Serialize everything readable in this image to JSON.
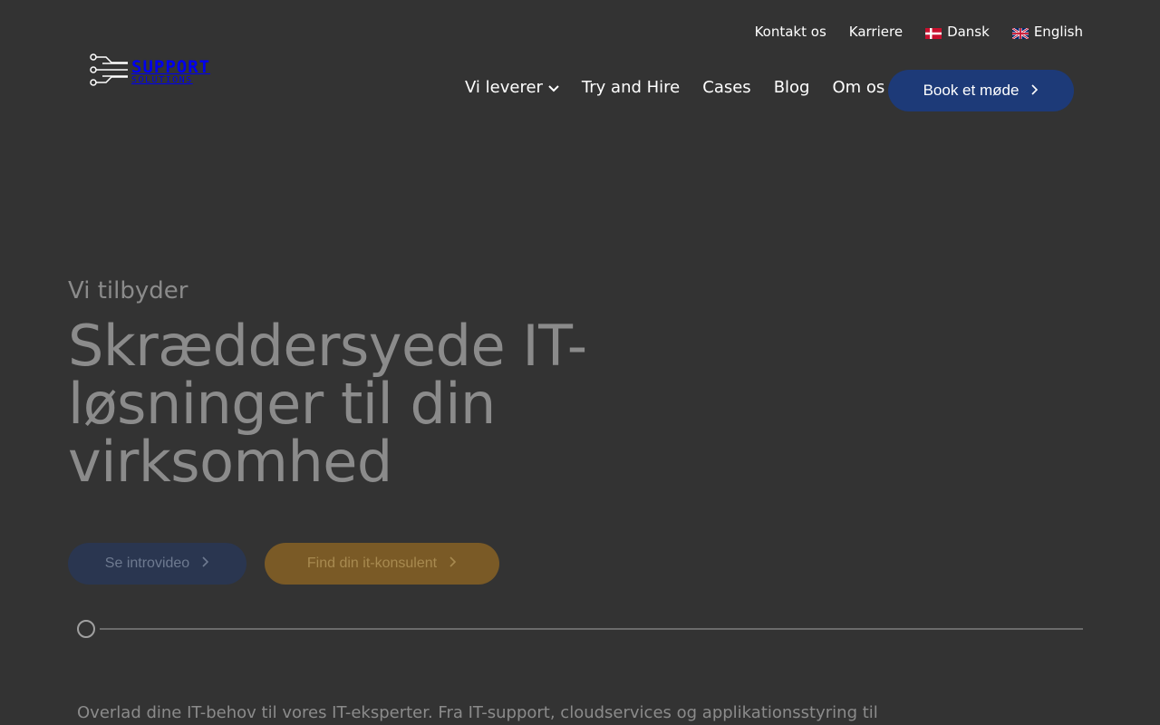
{
  "topbar": {
    "contact": "Kontakt os",
    "career": "Karriere",
    "lang_da": "Dansk",
    "lang_en": "English"
  },
  "logo": {
    "line1": "SUPPORT",
    "line2": "SOLUTIONS"
  },
  "nav": {
    "items": [
      "Vi leverer",
      "Try and Hire",
      "Cases",
      "Blog",
      "Om os"
    ],
    "cta": "Book et møde"
  },
  "hero": {
    "eyebrow": "Vi tilbyder",
    "headline_1": "Skræddersyede IT-",
    "headline_2": "løsninger til din",
    "headline_3": "virksomhed",
    "btn_video": "Se introvideo",
    "btn_find": "Find din it-konsulent"
  },
  "intro_text": "Overlad dine IT-behov til vores IT-eksperter. Fra IT-support, cloudservices og applikationsstyring til",
  "colors": {
    "background": "#333333",
    "primary_blue": "#1d3a78",
    "accent_gold": "#7a5a26",
    "muted_text": "#8b8b8b"
  },
  "icons": {
    "dropdown": "chevron-down-icon",
    "arrow": "chevron-right-icon",
    "flag_da": "denmark-flag-icon",
    "flag_en": "uk-flag-icon"
  }
}
